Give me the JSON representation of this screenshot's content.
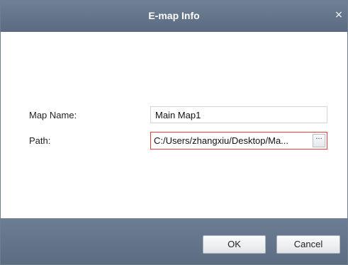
{
  "dialog": {
    "title": "E-map Info",
    "close_glyph": "×"
  },
  "form": {
    "map_name_label": "Map Name:",
    "map_name_value": "Main Map1",
    "path_label": "Path:",
    "path_value": "C:/Users/zhangxiu/Desktop/Ma...",
    "browse_glyph": "···"
  },
  "buttons": {
    "ok_label": "OK",
    "cancel_label": "Cancel"
  },
  "colors": {
    "titlebar": "#5f7186",
    "footer": "#62748a",
    "error_border": "#e53b3b"
  }
}
